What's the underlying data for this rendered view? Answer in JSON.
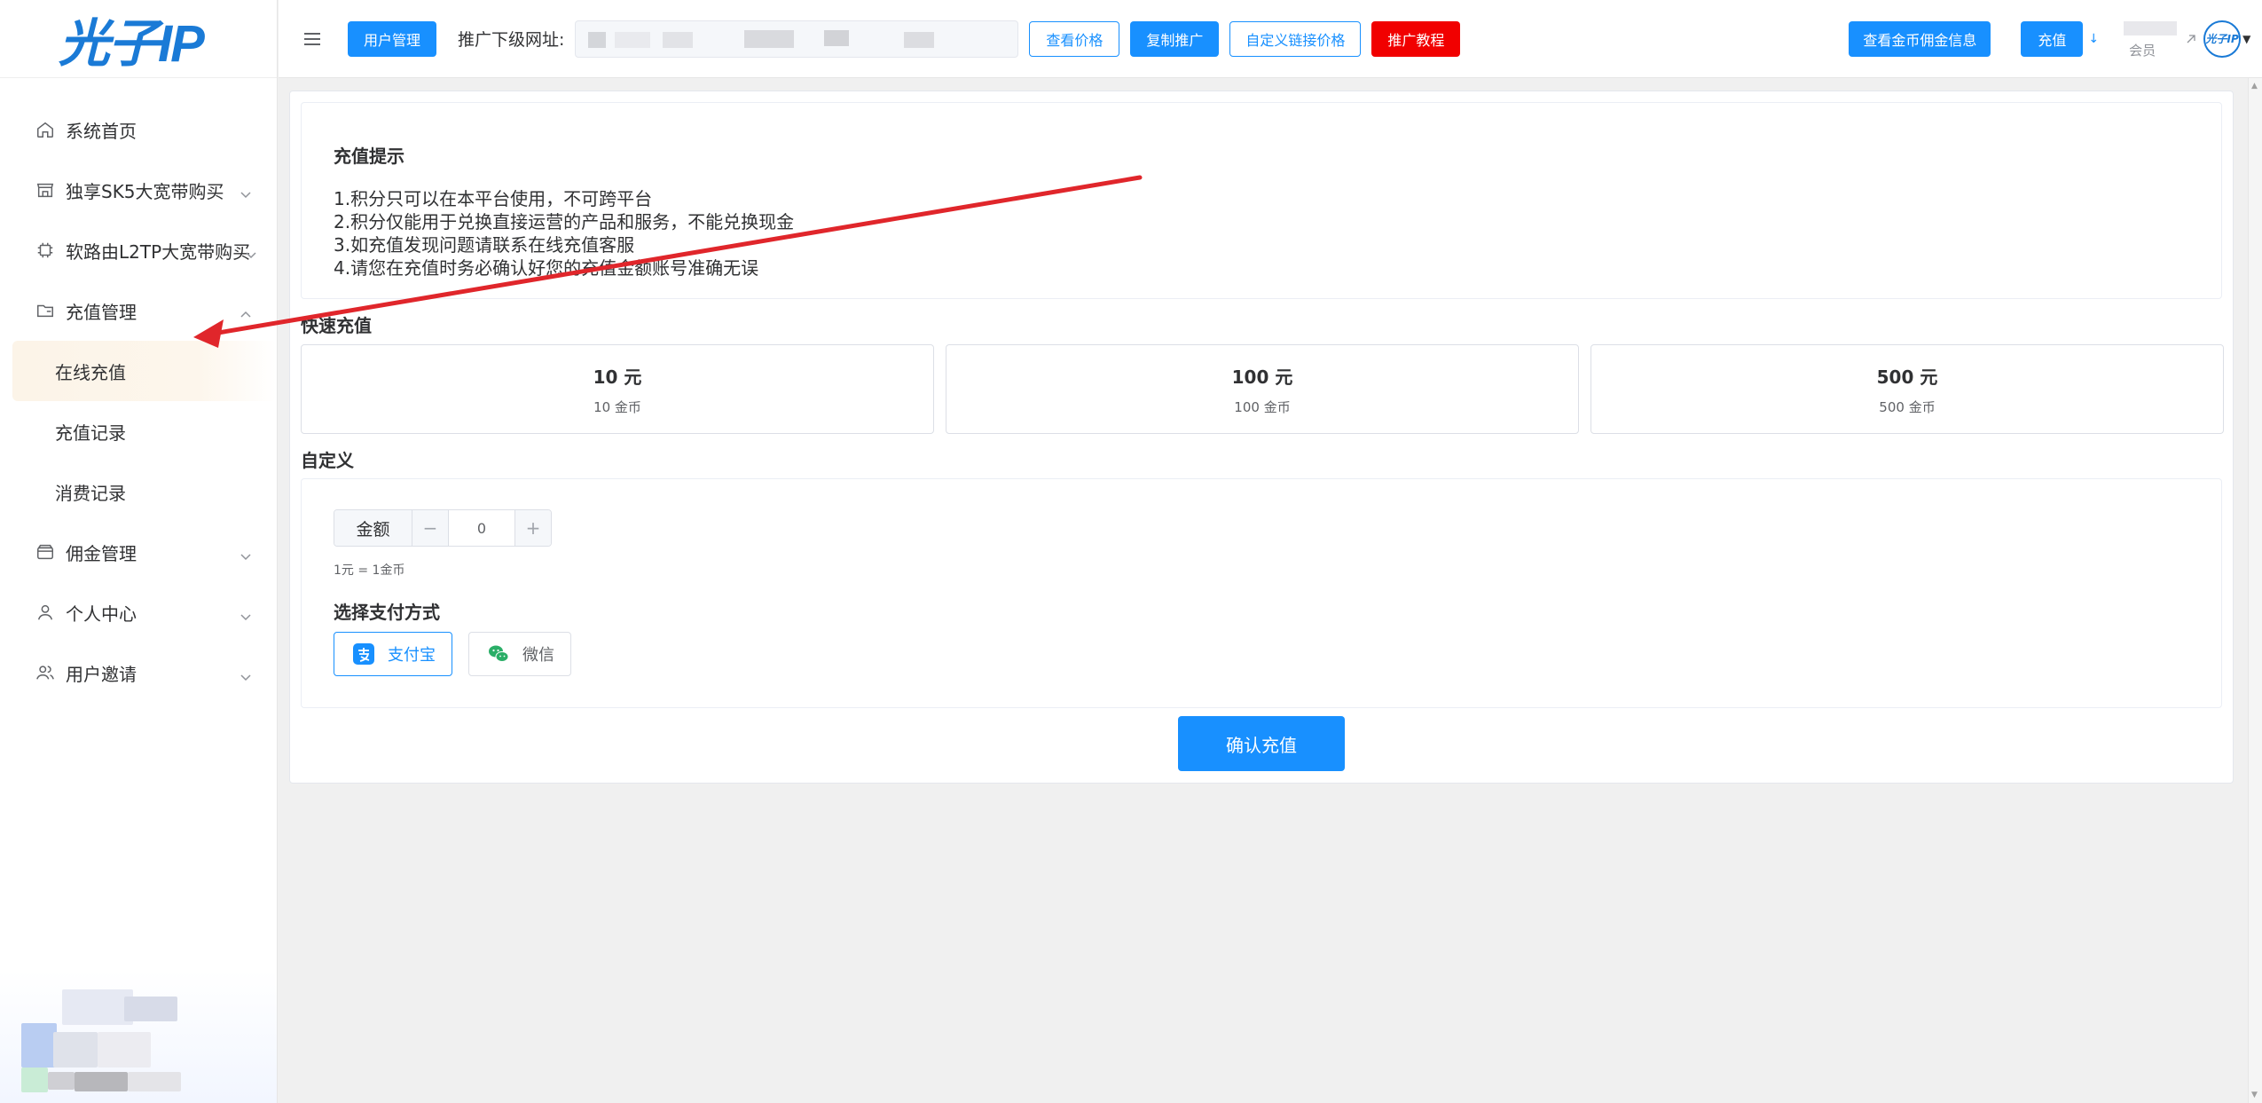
{
  "app": {
    "logo_text": "光子IP"
  },
  "sidebar": {
    "items": [
      {
        "label": "系统首页",
        "icon": "home-icon"
      },
      {
        "label": "独享SK5大宽带购买",
        "icon": "store-icon"
      },
      {
        "label": "软路由L2TP大宽带购买",
        "icon": "chip-icon"
      },
      {
        "label": "充值管理",
        "icon": "folder-icon",
        "expanded": true,
        "children": [
          "在线充值",
          "充值记录",
          "消费记录"
        ],
        "active_child": "在线充值"
      },
      {
        "label": "佣金管理",
        "icon": "wallet-icon"
      },
      {
        "label": "个人中心",
        "icon": "user-icon"
      },
      {
        "label": "用户邀请",
        "icon": "users-icon"
      }
    ]
  },
  "header": {
    "user_mgmt": "用户管理",
    "promo_label": "推广下级网址:",
    "view_price": "查看价格",
    "copy_promo": "复制推广",
    "custom_link_price": "自定义链接价格",
    "promo_tutorial": "推广教程",
    "view_coin_info": "查看金币佣金信息",
    "recharge": "充值",
    "user_partial": "会员"
  },
  "tips": {
    "title": "充值提示",
    "lines": [
      "1.积分只可以在本平台使用，不可跨平台",
      "2.积分仅能用于兑换直接运营的产品和服务，不能兑换现金",
      "3.如充值发现问题请联系在线充值客服",
      "4.请您在充值时务必确认好您的充值金额账号准确无误"
    ]
  },
  "quick": {
    "title": "快速充值",
    "options": [
      {
        "amount": "10 元",
        "coins": "10 金币"
      },
      {
        "amount": "100 元",
        "coins": "100 金币"
      },
      {
        "amount": "500 元",
        "coins": "500 金币"
      }
    ]
  },
  "custom": {
    "title": "自定义",
    "amount_label": "金额",
    "minus": "−",
    "plus": "+",
    "value": "0",
    "rate": "1元 = 1金币",
    "pay_title": "选择支付方式",
    "alipay": "支付宝",
    "wechat": "微信"
  },
  "confirm": "确认充值",
  "colors": {
    "primary": "#1890ff",
    "danger": "#f10000",
    "logo": "#1a7ad6",
    "annotation": "#e0262b"
  }
}
